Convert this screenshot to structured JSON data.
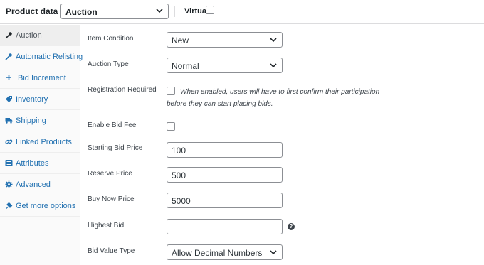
{
  "header": {
    "title": "Product data —",
    "product_type": "Auction",
    "virtual_label": "Virtual:"
  },
  "sidebar": {
    "items": [
      {
        "label": "Auction",
        "icon": "wrench-icon"
      },
      {
        "label": "Automatic Relisting",
        "icon": "wrench-icon"
      },
      {
        "label": "Bid Increment",
        "icon": "plus-icon"
      },
      {
        "label": "Inventory",
        "icon": "tag-icon"
      },
      {
        "label": "Shipping",
        "icon": "truck-icon"
      },
      {
        "label": "Linked Products",
        "icon": "link-icon"
      },
      {
        "label": "Attributes",
        "icon": "list-icon"
      },
      {
        "label": "Advanced",
        "icon": "gear-icon"
      },
      {
        "label": "Get more options",
        "icon": "plugin-icon"
      }
    ]
  },
  "form": {
    "item_condition": {
      "label": "Item Condition",
      "value": "New"
    },
    "auction_type": {
      "label": "Auction Type",
      "value": "Normal"
    },
    "registration_required": {
      "label": "Registration Required",
      "description": "When enabled, users will have to first confirm their participation before they can start placing bids."
    },
    "enable_bid_fee": {
      "label": "Enable Bid Fee"
    },
    "starting_bid_price": {
      "label": "Starting Bid Price",
      "value": "100"
    },
    "reserve_price": {
      "label": "Reserve Price",
      "value": "500"
    },
    "buy_now_price": {
      "label": "Buy Now Price",
      "value": "5000"
    },
    "highest_bid": {
      "label": "Highest Bid",
      "value": ""
    },
    "bid_value_type": {
      "label": "Bid Value Type",
      "value": "Allow Decimal Numbers"
    }
  },
  "colors": {
    "link": "#2271b1",
    "active_tab_bg": "#eeeeee",
    "sidebar_bg": "#fafafa"
  }
}
